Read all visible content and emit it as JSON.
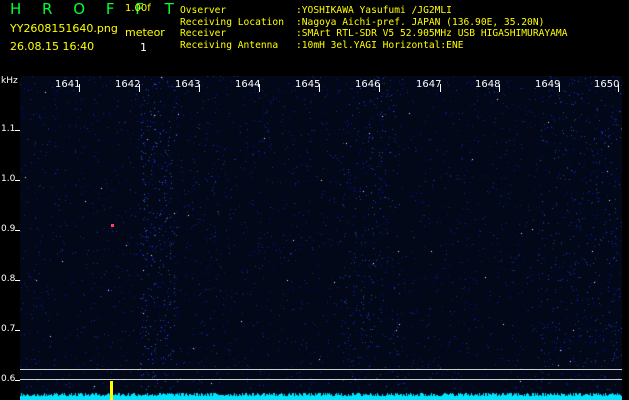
{
  "header": {
    "app_title": "H R O F F T",
    "app_version": "1.00f",
    "file_name": "YY2608151640.png",
    "datetime": "26.08.15 16:40",
    "meteor_label": "meteor",
    "meteor_count": "1"
  },
  "info": [
    {
      "key": "Ovserver",
      "value": ":YOSHIKAWA Yasufumi /JG2MLI"
    },
    {
      "key": "Receiving Location",
      "value": ":Nagoya Aichi-pref. JAPAN (136.90E, 35.20N)"
    },
    {
      "key": "Receiver",
      "value": ":SMArt RTL-SDR V5 52.905MHz USB HIGASHIMURAYAMA"
    },
    {
      "key": "Receiving Antenna",
      "value": ":10mH 3el.YAGI Horizontal:ENE"
    }
  ],
  "axis": {
    "unit": "kHz",
    "y_labels": [
      "1.1",
      "1.0",
      "0.9",
      "0.8",
      "0.7",
      "0.6"
    ],
    "x_labels": [
      "1641",
      "1642",
      "1643",
      "1644",
      "1645",
      "1646",
      "1647",
      "1648",
      "1649",
      "1650"
    ]
  },
  "colors": {
    "title": "#00ff33",
    "header_text": "#ffff00",
    "noise": "#1e50ff",
    "baseline": "#00e5ff",
    "marker": "#ffff00"
  }
}
